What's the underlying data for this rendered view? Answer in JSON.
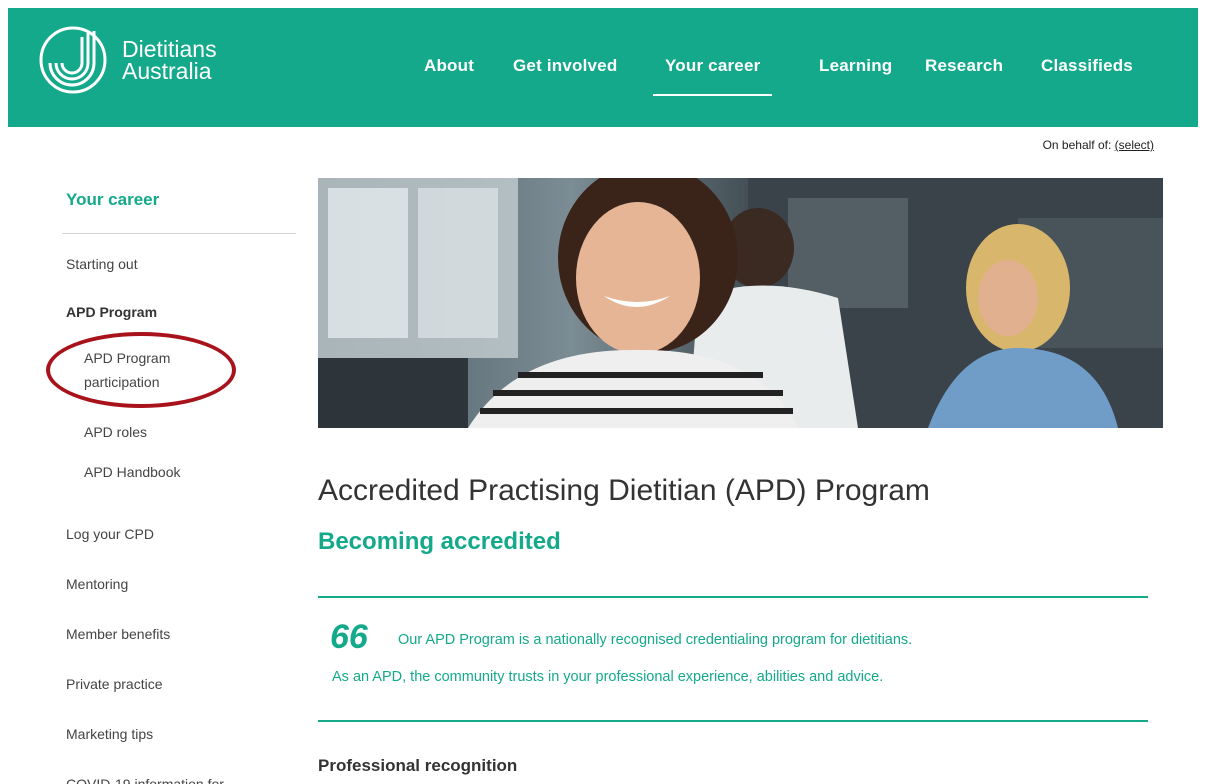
{
  "header": {
    "logo_line1": "Dietitians",
    "logo_line2": "Australia",
    "nav": [
      {
        "label": "About"
      },
      {
        "label": "Get involved"
      },
      {
        "label": "Your career"
      },
      {
        "label": "Learning"
      },
      {
        "label": "Research"
      },
      {
        "label": "Classifieds"
      }
    ],
    "active_nav": "Your career"
  },
  "behalf": {
    "label": "On behalf of:",
    "link": "(select)"
  },
  "sidebar": {
    "title": "Your career",
    "items": [
      {
        "label": "Starting out"
      },
      {
        "label": "APD Program"
      },
      {
        "label": "APD Program participation"
      },
      {
        "label": "APD roles"
      },
      {
        "label": "APD Handbook"
      },
      {
        "label": "Log your CPD"
      },
      {
        "label": "Mentoring"
      },
      {
        "label": "Member benefits"
      },
      {
        "label": "Private practice"
      },
      {
        "label": "Marketing tips"
      },
      {
        "label": "COVID-19 information for"
      }
    ]
  },
  "main": {
    "title": "Accredited Practising Dietitian (APD) Program",
    "subtitle": "Becoming accredited",
    "quote_mark": "66",
    "quote_line1": "Our APD Program is a nationally recognised credentialing program for dietitians.",
    "quote_line2": "As an APD, the community trusts in your professional experience, abilities and advice.",
    "section_heading": "Professional recognition"
  },
  "colors": {
    "brand_green": "#14a98b",
    "highlight_circle": "#a8121b"
  }
}
